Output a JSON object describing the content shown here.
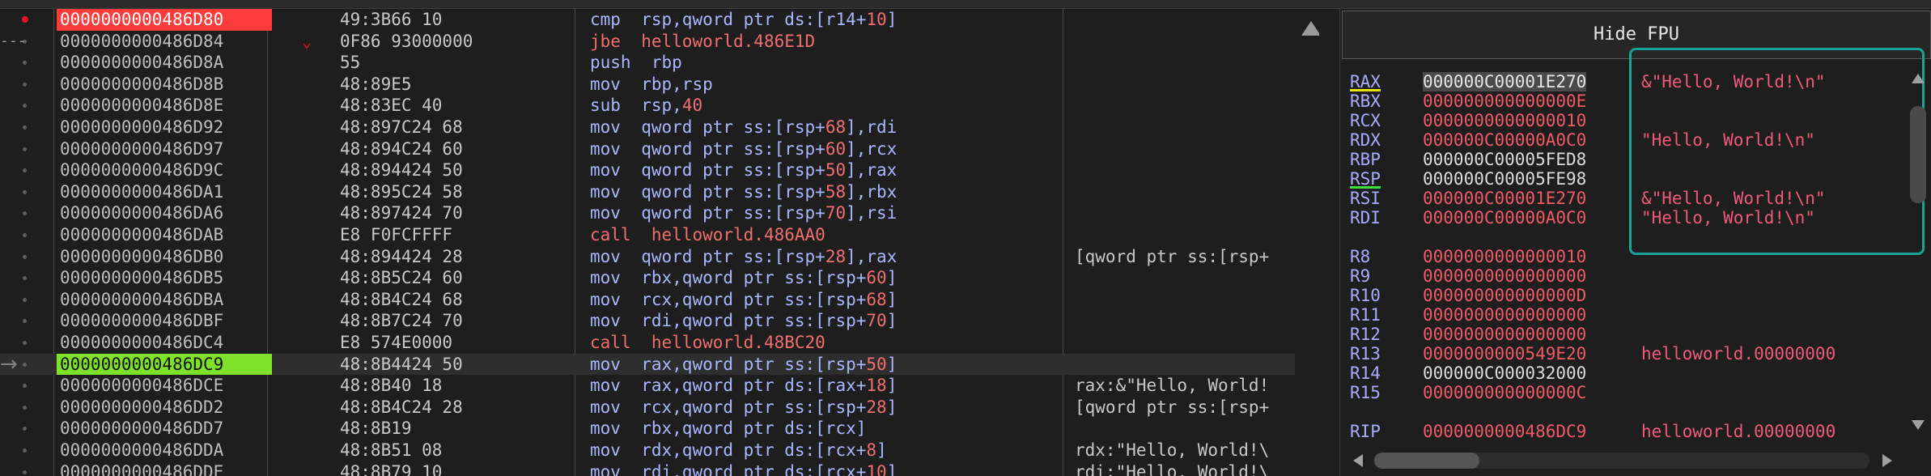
{
  "disasm": {
    "rows": [
      {
        "addr": "0000000000486D80",
        "bytes": "49:3B66 10",
        "mn": "cmp",
        "ops": [
          [
            "rsp,qword ptr ds:[r14+",
            ""
          ],
          [
            "10",
            "n"
          ],
          [
            "]",
            ""
          ]
        ],
        "comment": ""
      },
      {
        "addr": "0000000000486D84",
        "bytes": "0F86 93000000",
        "mn": "jbe",
        "ops": [
          [
            "helloworld.486E1D",
            "c"
          ]
        ],
        "comment": ""
      },
      {
        "addr": "0000000000486D8A",
        "bytes": "55",
        "mn": "push",
        "ops": [
          [
            "rbp",
            ""
          ]
        ],
        "comment": ""
      },
      {
        "addr": "0000000000486D8B",
        "bytes": "48:89E5",
        "mn": "mov",
        "ops": [
          [
            "rbp,rsp",
            ""
          ]
        ],
        "comment": ""
      },
      {
        "addr": "0000000000486D8E",
        "bytes": "48:83EC 40",
        "mn": "sub",
        "ops": [
          [
            "rsp,",
            ""
          ],
          [
            "40",
            "n"
          ]
        ],
        "comment": ""
      },
      {
        "addr": "0000000000486D92",
        "bytes": "48:897C24 68",
        "mn": "mov",
        "ops": [
          [
            "qword ptr ss:[rsp+",
            ""
          ],
          [
            "68",
            "n"
          ],
          [
            "],rdi",
            ""
          ]
        ],
        "comment": ""
      },
      {
        "addr": "0000000000486D97",
        "bytes": "48:894C24 60",
        "mn": "mov",
        "ops": [
          [
            "qword ptr ss:[rsp+",
            ""
          ],
          [
            "60",
            "n"
          ],
          [
            "],rcx",
            ""
          ]
        ],
        "comment": ""
      },
      {
        "addr": "0000000000486D9C",
        "bytes": "48:894424 50",
        "mn": "mov",
        "ops": [
          [
            "qword ptr ss:[rsp+",
            ""
          ],
          [
            "50",
            "n"
          ],
          [
            "],rax",
            ""
          ]
        ],
        "comment": ""
      },
      {
        "addr": "0000000000486DA1",
        "bytes": "48:895C24 58",
        "mn": "mov",
        "ops": [
          [
            "qword ptr ss:[rsp+",
            ""
          ],
          [
            "58",
            "n"
          ],
          [
            "],rbx",
            ""
          ]
        ],
        "comment": ""
      },
      {
        "addr": "0000000000486DA6",
        "bytes": "48:897424 70",
        "mn": "mov",
        "ops": [
          [
            "qword ptr ss:[rsp+",
            ""
          ],
          [
            "70",
            "n"
          ],
          [
            "],rsi",
            ""
          ]
        ],
        "comment": ""
      },
      {
        "addr": "0000000000486DAB",
        "bytes": "E8 F0FCFFFF",
        "mn": "call",
        "ops": [
          [
            "helloworld.486AA0",
            "c"
          ]
        ],
        "comment": ""
      },
      {
        "addr": "0000000000486DB0",
        "bytes": "48:894424 28",
        "mn": "mov",
        "ops": [
          [
            "qword ptr ss:[rsp+",
            ""
          ],
          [
            "28",
            "n"
          ],
          [
            "],rax",
            ""
          ]
        ],
        "comment": "[qword ptr ss:[rsp+"
      },
      {
        "addr": "0000000000486DB5",
        "bytes": "48:8B5C24 60",
        "mn": "mov",
        "ops": [
          [
            "rbx,qword ptr ss:[rsp+",
            ""
          ],
          [
            "60",
            "n"
          ],
          [
            "]",
            ""
          ]
        ],
        "comment": ""
      },
      {
        "addr": "0000000000486DBA",
        "bytes": "48:8B4C24 68",
        "mn": "mov",
        "ops": [
          [
            "rcx,qword ptr ss:[rsp+",
            ""
          ],
          [
            "68",
            "n"
          ],
          [
            "]",
            ""
          ]
        ],
        "comment": ""
      },
      {
        "addr": "0000000000486DBF",
        "bytes": "48:8B7C24 70",
        "mn": "mov",
        "ops": [
          [
            "rdi,qword ptr ss:[rsp+",
            ""
          ],
          [
            "70",
            "n"
          ],
          [
            "]",
            ""
          ]
        ],
        "comment": ""
      },
      {
        "addr": "0000000000486DC4",
        "bytes": "E8 574E0000",
        "mn": "call",
        "ops": [
          [
            "helloworld.48BC20",
            "c"
          ]
        ],
        "comment": ""
      },
      {
        "addr": "0000000000486DC9",
        "bytes": "48:8B4424 50",
        "mn": "mov",
        "ops": [
          [
            "rax,qword ptr ss:[rsp+",
            ""
          ],
          [
            "50",
            "n"
          ],
          [
            "]",
            ""
          ]
        ],
        "comment": ""
      },
      {
        "addr": "0000000000486DCE",
        "bytes": "48:8B40 18",
        "mn": "mov",
        "ops": [
          [
            "rax,qword ptr ds:[rax+",
            ""
          ],
          [
            "18",
            "n"
          ],
          [
            "]",
            ""
          ]
        ],
        "comment": "rax:&\"Hello, World!"
      },
      {
        "addr": "0000000000486DD2",
        "bytes": "48:8B4C24 28",
        "mn": "mov",
        "ops": [
          [
            "rcx,qword ptr ss:[rsp+",
            ""
          ],
          [
            "28",
            "n"
          ],
          [
            "]",
            ""
          ]
        ],
        "comment": "[qword ptr ss:[rsp+"
      },
      {
        "addr": "0000000000486DD7",
        "bytes": "48:8B19",
        "mn": "mov",
        "ops": [
          [
            "rbx,qword ptr ds:[rcx]",
            ""
          ]
        ],
        "comment": ""
      },
      {
        "addr": "0000000000486DDA",
        "bytes": "48:8B51 08",
        "mn": "mov",
        "ops": [
          [
            "rdx,qword ptr ds:[rcx+",
            ""
          ],
          [
            "8",
            "n"
          ],
          [
            "]",
            ""
          ]
        ],
        "comment": "rdx:\"Hello, World!\\"
      },
      {
        "addr": "0000000000486DDE",
        "bytes": "48:8B79 10",
        "mn": "mov",
        "ops": [
          [
            "rdi,qword ptr ds:[rcx+",
            ""
          ],
          [
            "10",
            "n"
          ],
          [
            "]",
            ""
          ]
        ],
        "comment": "rdi:\"Hello, World!\\"
      }
    ]
  },
  "registers": {
    "hide_fpu_label": "Hide FPU",
    "rows": [
      {
        "name": "RAX",
        "value": "000000C00001E270",
        "comment": "&\"Hello, World!\\n\""
      },
      {
        "name": "RBX",
        "value": "000000000000000E",
        "comment": ""
      },
      {
        "name": "RCX",
        "value": "0000000000000010",
        "comment": ""
      },
      {
        "name": "RDX",
        "value": "000000C00000A0C0",
        "comment": "\"Hello, World!\\n\""
      },
      {
        "name": "RBP",
        "value": "000000C00005FED8",
        "comment": ""
      },
      {
        "name": "RSP",
        "value": "000000C00005FE98",
        "comment": ""
      },
      {
        "name": "RSI",
        "value": "000000C00001E270",
        "comment": "&\"Hello, World!\\n\""
      },
      {
        "name": "RDI",
        "value": "000000C00000A0C0",
        "comment": "\"Hello, World!\\n\""
      },
      {
        "name": "R8",
        "value": "0000000000000010",
        "comment": ""
      },
      {
        "name": "R9",
        "value": "0000000000000000",
        "comment": ""
      },
      {
        "name": "R10",
        "value": "000000000000000D",
        "comment": ""
      },
      {
        "name": "R11",
        "value": "0000000000000000",
        "comment": ""
      },
      {
        "name": "R12",
        "value": "0000000000000000",
        "comment": ""
      },
      {
        "name": "R13",
        "value": "0000000000549E20",
        "comment": "helloworld.00000000"
      },
      {
        "name": "R14",
        "value": "000000C000032000",
        "comment": ""
      },
      {
        "name": "R15",
        "value": "000000000000000C",
        "comment": ""
      },
      {
        "name": "RIP",
        "value": "0000000000486DC9",
        "comment": "helloworld.00000000"
      }
    ]
  },
  "colors": {
    "breakpoint_address_bg": "#ff3c3c",
    "rip_address_bg": "#7ee12a",
    "modified_value": "#f05a64",
    "register_name": "#a9a9ff",
    "annotation_box": "#17a398"
  }
}
